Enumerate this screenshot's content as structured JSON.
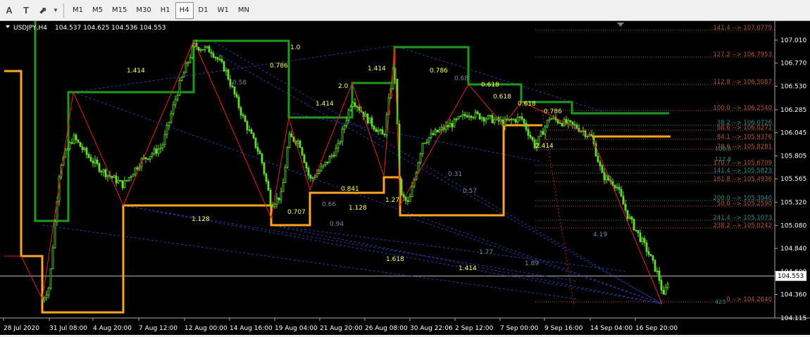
{
  "toolbar": {
    "tools": [
      {
        "name": "text-tool",
        "glyph": "A"
      },
      {
        "name": "text-label-tool",
        "glyph": "T"
      },
      {
        "name": "arrows-tool",
        "glyph": "⬈"
      }
    ],
    "timeframes": [
      "M1",
      "M5",
      "M15",
      "M30",
      "H1",
      "H4",
      "D1",
      "W1",
      "MN"
    ],
    "active_timeframe": "H4"
  },
  "chart_info": {
    "symbol_label": "USDJPY,H4",
    "ohlc": "104.537 104.625 104.536 104.553",
    "current_price": "104.553"
  },
  "price_axis": [
    "107.010",
    "106.770",
    "106.530",
    "106.285",
    "106.045",
    "105.805",
    "105.565",
    "105.320",
    "105.080",
    "104.840",
    "104.600",
    "104.360",
    "104.115"
  ],
  "time_axis": [
    "28 Jul 2020",
    "31 Jul 08:00",
    "4 Aug 20:00",
    "7 Aug 12:00",
    "12 Aug 00:00",
    "14 Aug 16:00",
    "19 Aug 04:00",
    "21 Aug 20:00",
    "26 Aug 08:00",
    "30 Aug 22:06",
    "2 Sep 12:00",
    "7 Sep 00:00",
    "9 Sep 16:00",
    "14 Sep 04:00",
    "16 Sep 20:00"
  ],
  "fib_levels": [
    {
      "text": "141.4  -->  107.0779",
      "color": "#b05a2a"
    },
    {
      "text": "127.2  -->  106.7953",
      "color": "#b05a2a"
    },
    {
      "text": "112.8  -->  106.5087",
      "color": "#b05a2a"
    },
    {
      "text": "100.0  -->  106.2540",
      "color": "#b05a2a"
    },
    {
      "text": "38.2  -->  106.0726",
      "color": "#2a8a8a"
    },
    {
      "text": "88.6  -->  106.0271",
      "color": "#b05a2a"
    },
    {
      "text": "84.1  -->  105.9376",
      "color": "#b05a2a"
    },
    {
      "text": "78.6  -->  105.8281",
      "color": "#b05a2a"
    },
    {
      "text": "170.7  -->  105.6709",
      "color": "#b05a2a"
    },
    {
      "text": "141.4  -->  105.5823",
      "color": "#2a8a8a"
    },
    {
      "text": "161.8  -->  105.4936",
      "color": "#b05a2a"
    },
    {
      "text": "200.0  -->  105.3940",
      "color": "#2a8a8a"
    },
    {
      "text": "50.0  -->  105.2590",
      "color": "#b05a2a"
    },
    {
      "text": "241.4  -->  105.1073",
      "color": "#2a8a8a"
    },
    {
      "text": "238.2  -->  105.0242",
      "color": "#b05a2a"
    },
    {
      "text": "0  -->  104.2640",
      "color": "#b05a2a"
    }
  ],
  "fib_partial_labels": [
    "100.0",
    "112.8",
    "423"
  ],
  "ratio_labels_yellow": [
    "1.414",
    "1.0",
    "0.786",
    "1.414",
    "1.414",
    "2.0",
    "0.786",
    "0.618",
    "0.618",
    "0.618",
    "0.786",
    "2.414",
    "0.841",
    "0.707",
    "1.128",
    "1.27",
    "1.128",
    "1.618",
    "1.414"
  ],
  "ratio_labels_gray": [
    "0.68",
    "0.58",
    "0.31",
    "0.57",
    "0.66",
    "0.94",
    "1.77",
    "1.89",
    "4.19"
  ],
  "colors": {
    "background": "#000000",
    "bull_candle": "#66dd33",
    "bear_candle": "#66dd33",
    "zigzag": "#e02020",
    "green_channel": "#1f9a1f",
    "orange_channel": "#ffa520",
    "grid": "#ffffff",
    "axis_text": "#ffffff"
  }
}
